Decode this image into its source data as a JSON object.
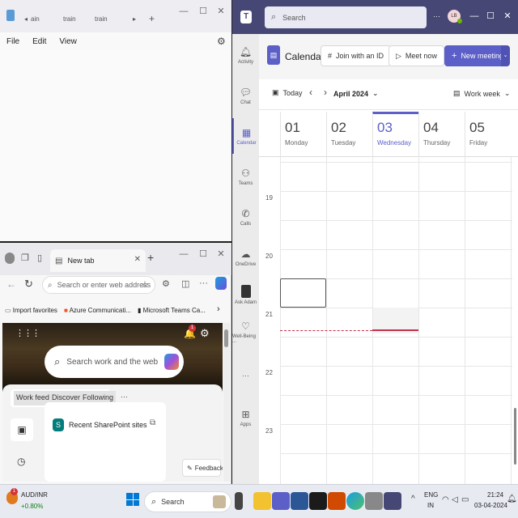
{
  "notepad": {
    "tabs": [
      "ain",
      "train",
      "train"
    ],
    "menu": [
      "File",
      "Edit",
      "View"
    ]
  },
  "edge": {
    "tab_title": "New tab",
    "address_placeholder": "Search or enter web address",
    "favorites": [
      "Import favorites",
      "Azure Communicati...",
      "Microsoft Teams Ca..."
    ],
    "search_placeholder": "Search work and the web",
    "notification_count": "1",
    "feed_tabs": [
      "Work feed",
      "Discover",
      "Following"
    ],
    "more_label": "···",
    "card_title": "Recent SharePoint sites",
    "feedback_label": "Feedback"
  },
  "teams": {
    "search_placeholder": "Search",
    "more_label": "···",
    "avatar_initials": "LB",
    "rail": [
      {
        "label": "Activity",
        "icon": "bell-icon"
      },
      {
        "label": "Chat",
        "icon": "chat-icon"
      },
      {
        "label": "Calendar",
        "icon": "calendar-icon"
      },
      {
        "label": "Teams",
        "icon": "teams-icon"
      },
      {
        "label": "Calls",
        "icon": "phone-icon"
      },
      {
        "label": "OneDrive",
        "icon": "cloud-icon"
      },
      {
        "label": "Ask Adam",
        "icon": "avatar-icon"
      },
      {
        "label": "Well-Being ...",
        "icon": "wellbeing-icon"
      }
    ],
    "rail_more": "···",
    "rail_apps": "Apps",
    "calendar": {
      "title": "Calendar",
      "join_label": "Join with an ID",
      "meet_label": "Meet now",
      "new_meeting_label": "New meeting",
      "today_label": "Today",
      "month_label": "April 2024",
      "view_label": "Work week",
      "days": [
        {
          "num": "01",
          "name": "Monday"
        },
        {
          "num": "02",
          "name": "Tuesday"
        },
        {
          "num": "03",
          "name": "Wednesday"
        },
        {
          "num": "04",
          "name": "Thursday"
        },
        {
          "num": "05",
          "name": "Friday"
        }
      ],
      "hours": [
        "19",
        "20",
        "21",
        "22",
        "23"
      ]
    }
  },
  "taskbar": {
    "stock_name": "AUD/INR",
    "stock_change": "+0.80%",
    "stock_badge": "1",
    "search_label": "Search",
    "lang_line1": "ENG",
    "lang_line2": "IN",
    "time": "21:24",
    "date": "03-04-2024"
  },
  "colors": {
    "teams_accent": "#5b5fc7",
    "teams_topbar": "#464775",
    "time_indicator": "#c4314b"
  }
}
